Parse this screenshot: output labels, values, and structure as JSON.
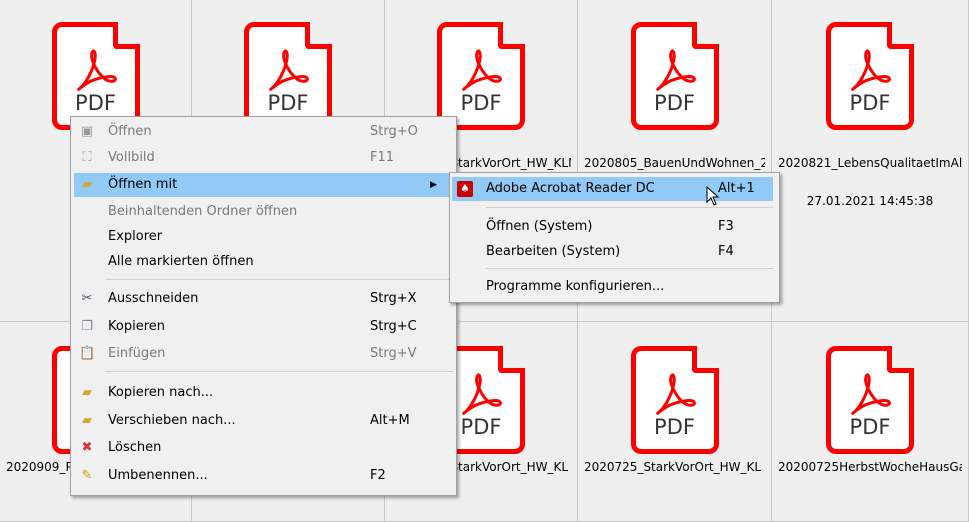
{
  "files": [
    {
      "name": "",
      "date": ""
    },
    {
      "name": "",
      "date": ""
    },
    {
      "name": "2020805_StarkVorOrt_HW_KLN...",
      "date": ""
    },
    {
      "name": "2020805_BauenUndWohnen_20...",
      "date": ""
    },
    {
      "name": "2020821_LebensQualitaetImAlt...",
      "date": "27.01.2021 14:45:38"
    },
    {
      "name": "2020909_Pa",
      "date": ""
    },
    {
      "name": "",
      "date": ""
    },
    {
      "name": "2020725_StarkVorOrt_HW_KL",
      "date": ""
    },
    {
      "name": "2020725_StarkVorOrt_HW_KL",
      "date": ""
    },
    {
      "name": "20200725HerbstWocheHausGar",
      "date": ""
    }
  ],
  "pdf_label": "PDF",
  "context_menu": [
    {
      "label": "Öffnen",
      "shortcut": "Strg+O",
      "icon": "open-icon"
    },
    {
      "label": "Vollbild",
      "shortcut": "F11",
      "icon": "fullscreen-icon"
    },
    {
      "label": "Öffnen mit",
      "shortcut": "",
      "icon": "folder-open-with-icon"
    },
    {
      "label": "Beinhaltenden Ordner öffnen",
      "shortcut": ""
    },
    {
      "label": "Explorer",
      "shortcut": ""
    },
    {
      "label": "Alle markierten öffnen",
      "shortcut": ""
    },
    {
      "label": "Ausschneiden",
      "shortcut": "Strg+X",
      "icon": "scissors-icon"
    },
    {
      "label": "Kopieren",
      "shortcut": "Strg+C",
      "icon": "copy-icon"
    },
    {
      "label": "Einfügen",
      "shortcut": "Strg+V",
      "icon": "paste-icon"
    },
    {
      "label": "Kopieren nach...",
      "shortcut": "",
      "icon": "copy-to-icon"
    },
    {
      "label": "Verschieben nach...",
      "shortcut": "Alt+M",
      "icon": "move-to-icon"
    },
    {
      "label": "Löschen",
      "shortcut": "",
      "icon": "delete-icon"
    },
    {
      "label": "Umbenennen...",
      "shortcut": "F2",
      "icon": "rename-icon"
    }
  ],
  "submenu": [
    {
      "label": "Adobe Acrobat Reader DC",
      "shortcut": "Alt+1"
    },
    {
      "label": "Öffnen (System)",
      "shortcut": "F3"
    },
    {
      "label": "Bearbeiten (System)",
      "shortcut": "F4"
    },
    {
      "label": "Programme konfigurieren...",
      "shortcut": ""
    }
  ]
}
